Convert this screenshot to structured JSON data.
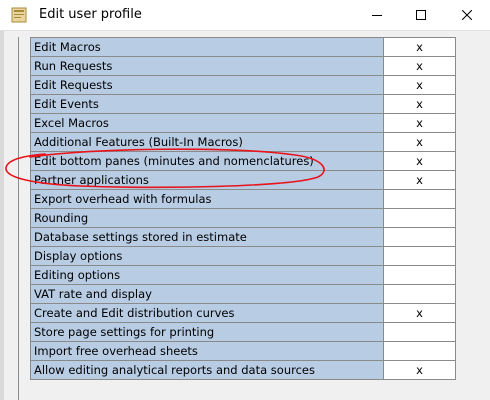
{
  "window": {
    "title": "Edit user profile",
    "buttons": [
      "minimize",
      "maximize",
      "close"
    ],
    "icon": "app-icon"
  },
  "colors": {
    "name_cell_bg": "#b8cce4",
    "flag_cell_bg": "#ffffff",
    "annotation_stroke": "#e8141b"
  },
  "permissions": {
    "rows": [
      {
        "label": "Edit Macros",
        "value": "x"
      },
      {
        "label": "Run Requests",
        "value": "x"
      },
      {
        "label": "Edit Requests",
        "value": "x"
      },
      {
        "label": "Edit Events",
        "value": "x"
      },
      {
        "label": "Excel Macros",
        "value": "x"
      },
      {
        "label": "Additional Features (Built-In Macros)",
        "value": "x"
      },
      {
        "label": "Edit bottom panes (minutes and nomenclatures)",
        "value": "x"
      },
      {
        "label": "Partner applications",
        "value": "x"
      },
      {
        "label": "Export overhead with formulas",
        "value": ""
      },
      {
        "label": "Rounding",
        "value": ""
      },
      {
        "label": "Database settings stored in estimate",
        "value": ""
      },
      {
        "label": "Display options",
        "value": ""
      },
      {
        "label": "Editing options",
        "value": ""
      },
      {
        "label": "VAT rate and display",
        "value": ""
      },
      {
        "label": "Create and Edit distribution curves",
        "value": "x"
      },
      {
        "label": "Store page settings for printing",
        "value": ""
      },
      {
        "label": "Import free overhead sheets",
        "value": ""
      },
      {
        "label": "Allow editing analytical reports and data sources",
        "value": "x"
      }
    ]
  },
  "annotation": {
    "type": "hand-drawn-ellipse",
    "highlights_row": "Edit bottom panes (minutes and nomenclatures)"
  }
}
